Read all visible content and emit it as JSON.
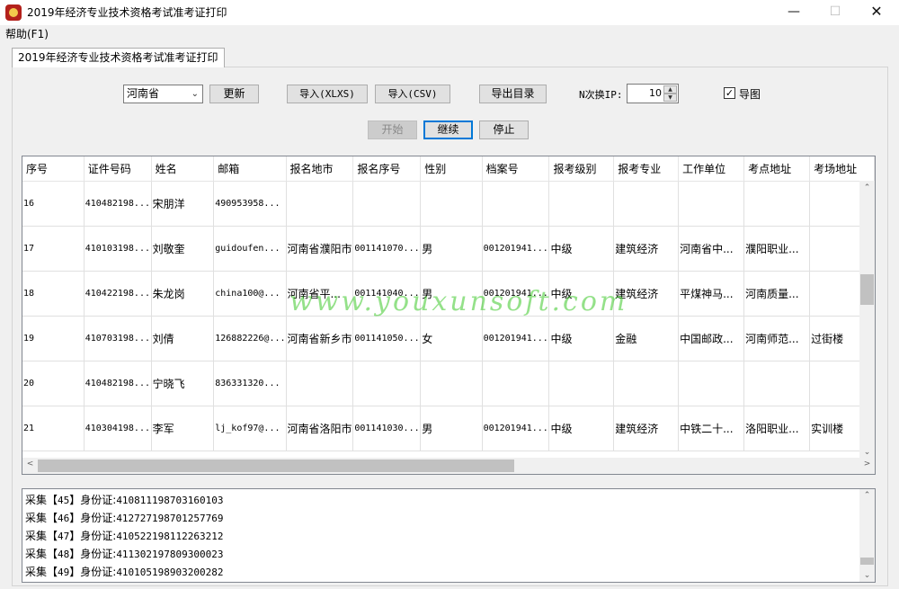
{
  "window": {
    "title": "2019年经济专业技术资格考试准考证打印"
  },
  "menu": {
    "help": "帮助(F1)"
  },
  "tab": {
    "label": "2019年经济专业技术资格考试准考证打印"
  },
  "toolbar": {
    "province": "河南省",
    "refresh": "更新",
    "import_xlsx": "导入(XLXS)",
    "import_csv": "导入(CSV)",
    "export_dir": "导出目录",
    "ip_label": "N次换IP:",
    "ip_value": "10",
    "export_img_label": "导图",
    "start": "开始",
    "continue": "继续",
    "stop": "停止"
  },
  "table": {
    "headers": [
      "序号",
      "证件号码",
      "姓名",
      "邮箱",
      "报名地市",
      "报名序号",
      "性别",
      "档案号",
      "报考级别",
      "报考专业",
      "工作单位",
      "考点地址",
      "考场地址"
    ],
    "rows": [
      [
        "16",
        "410482198...",
        "宋朋洋",
        "490953958...",
        "",
        "",
        "",
        "",
        "",
        "",
        "",
        "",
        ""
      ],
      [
        "17",
        "410103198...",
        "刘敬奎",
        "guidoufen...",
        "河南省濮阳市",
        "001141070...",
        "男",
        "001201941...",
        "中级",
        "建筑经济",
        "河南省中...",
        "濮阳职业...",
        ""
      ],
      [
        "18",
        "410422198...",
        "朱龙岗",
        "china100@...",
        "河南省平...",
        "001141040...",
        "男",
        "001201941...",
        "中级",
        "建筑经济",
        "平煤神马...",
        "河南质量...",
        ""
      ],
      [
        "19",
        "410703198...",
        "刘倩",
        "126882226@...",
        "河南省新乡市",
        "001141050...",
        "女",
        "001201941...",
        "中级",
        "金融",
        "中国邮政...",
        "河南师范...",
        "过街楼"
      ],
      [
        "20",
        "410482198...",
        "宁晓飞",
        "836331320...",
        "",
        "",
        "",
        "",
        "",
        "",
        "",
        "",
        ""
      ],
      [
        "21",
        "410304198...",
        "李军",
        "lj_kof97@...",
        "河南省洛阳市",
        "001141030...",
        "男",
        "001201941...",
        "中级",
        "建筑经济",
        "中铁二十...",
        "洛阳职业...",
        "实训楼"
      ]
    ]
  },
  "log": [
    {
      "prefix": "采集【",
      "num": "45",
      "mid": "】身份证:",
      "id": "410811198703160103"
    },
    {
      "prefix": "采集【",
      "num": "46",
      "mid": "】身份证:",
      "id": "412727198701257769"
    },
    {
      "prefix": "采集【",
      "num": "47",
      "mid": "】身份证:",
      "id": "410522198112263212"
    },
    {
      "prefix": "采集【",
      "num": "48",
      "mid": "】身份证:",
      "id": "411302197809300023"
    },
    {
      "prefix": "采集【",
      "num": "49",
      "mid": "】身份证:",
      "id": "410105198903200282"
    }
  ],
  "watermark": "www.youxunsoft.com"
}
